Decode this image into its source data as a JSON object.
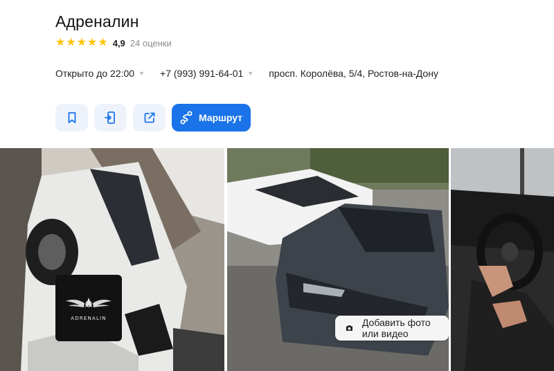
{
  "business": {
    "name": "Адреналин",
    "rating_value": "4,9",
    "rating_stars": 5,
    "rating_count": "24 оценки"
  },
  "info": {
    "hours": "Открыто до 22:00",
    "phone": "+7 (993) 991-64-01",
    "address": "просп. Королёва, 5/4, Ростов-на-Дону"
  },
  "actions": {
    "bookmark_icon": "bookmark-icon",
    "phone_icon": "phone-send-icon",
    "share_icon": "share-icon",
    "route_label": "Маршрут",
    "route_icon": "route-icon"
  },
  "gallery": {
    "logo_text": "ADRENALIN",
    "add_photo_label": "Добавить фото или видео",
    "add_photo_icon": "camera-icon"
  },
  "colors": {
    "star": "#fec400",
    "accent": "#1a73e8",
    "action_bg": "#eef3fb"
  }
}
